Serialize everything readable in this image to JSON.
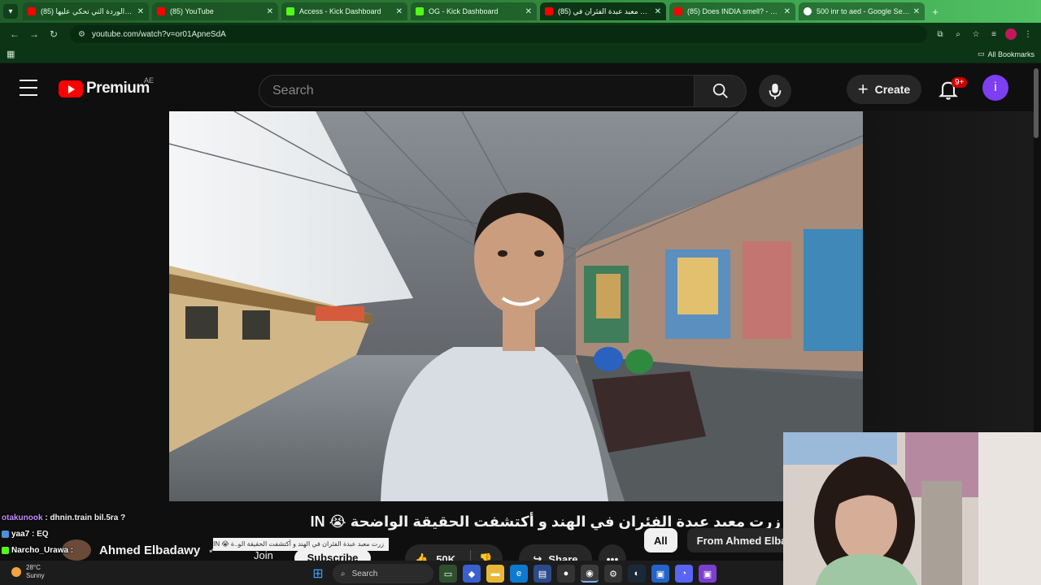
{
  "browser": {
    "tabs": [
      {
        "label": "(85) الوردة التي تحكي عليها - YouTube",
        "favicon": "youtube",
        "active": false
      },
      {
        "label": "(85) YouTube",
        "favicon": "youtube",
        "active": false
      },
      {
        "label": "Access - Kick Dashboard",
        "favicon": "kick",
        "active": false
      },
      {
        "label": "OG - Kick Dashboard",
        "favicon": "kick",
        "active": false
      },
      {
        "label": "(85) زرت معبد عبدة الفئران في",
        "favicon": "youtube",
        "active": true
      },
      {
        "label": "(85) Does INDIA smell? - YouTube",
        "favicon": "youtube",
        "active": false
      },
      {
        "label": "500 inr to aed - Google Search",
        "favicon": "google",
        "active": false
      }
    ],
    "url": "youtube.com/watch?v=or01ApneSdA",
    "all_bookmarks": "All Bookmarks"
  },
  "youtube": {
    "logo_text": "Premium",
    "country": "AE",
    "search_placeholder": "Search",
    "create_label": "Create",
    "notification_badge": "9+",
    "avatar_letter": "i"
  },
  "video": {
    "title": "زرت معبد عبدة الفئران في الهند و أكتشفت الحقيقة الواضحة 😭 IN",
    "channel": "Ahmed Elbadawy",
    "join_label": "Join",
    "subscribe_label": "Subscribe",
    "likes": "50K",
    "share_label": "Share",
    "more_label": "•••"
  },
  "chips": [
    "All",
    "From Ahmed Elba"
  ],
  "chat": [
    {
      "user": "otakunook",
      "message": "dhnin.train bil.5ra ?"
    },
    {
      "user": "yaa7",
      "message": "EQ"
    },
    {
      "user": "Narcho_Urawa",
      "message": ""
    }
  ],
  "tooltip": "زرت معبد عبدة الفئران في الهند و أكتشفت الحقيقة الو..ة 😭 IN",
  "taskbar": {
    "temperature": "28°C",
    "condition": "Sunny",
    "search_placeholder": "Search"
  },
  "colors": {
    "youtube_red": "#ff0000",
    "browser_green": "#0c3515",
    "avatar_purple": "#7e3ff2",
    "kick_green": "#53fc18"
  }
}
